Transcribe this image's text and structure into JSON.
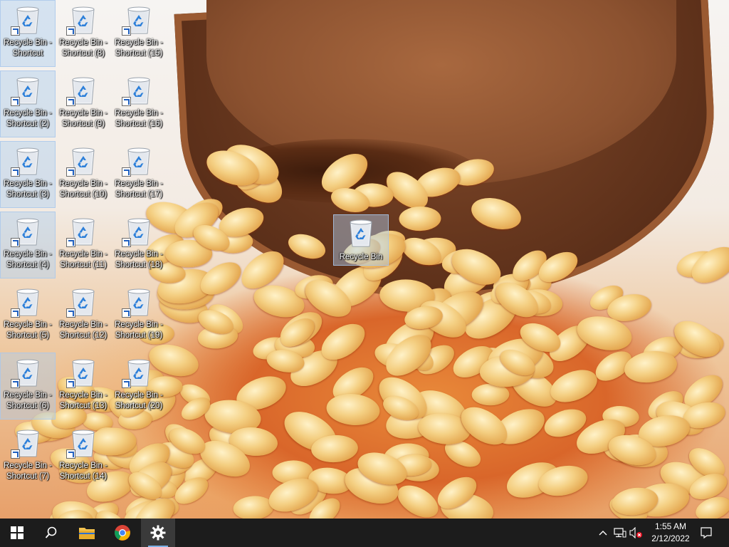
{
  "desktop": {
    "icons": [
      {
        "label": "Recycle Bin -\nShortcut",
        "shortcut": true
      },
      {
        "label": "Recycle Bin -\nShortcut (2)",
        "shortcut": true
      },
      {
        "label": "Recycle Bin -\nShortcut (3)",
        "shortcut": true
      },
      {
        "label": "Recycle Bin -\nShortcut (4)",
        "shortcut": true
      },
      {
        "label": "Recycle Bin -\nShortcut (5)",
        "shortcut": true
      },
      {
        "label": "Recycle Bin -\nShortcut (6)",
        "shortcut": true
      },
      {
        "label": "Recycle Bin -\nShortcut (7)",
        "shortcut": true
      },
      {
        "label": "Recycle Bin -\nShortcut (8)",
        "shortcut": true
      },
      {
        "label": "Recycle Bin -\nShortcut (9)",
        "shortcut": true
      },
      {
        "label": "Recycle Bin -\nShortcut (10)",
        "shortcut": true
      },
      {
        "label": "Recycle Bin -\nShortcut (11)",
        "shortcut": true
      },
      {
        "label": "Recycle Bin -\nShortcut (12)",
        "shortcut": true
      },
      {
        "label": "Recycle Bin -\nShortcut (13)",
        "shortcut": true
      },
      {
        "label": "Recycle Bin -\nShortcut (14)",
        "shortcut": true
      },
      {
        "label": "Recycle Bin -\nShortcut (15)",
        "shortcut": true
      },
      {
        "label": "Recycle Bin -\nShortcut (16)",
        "shortcut": true
      },
      {
        "label": "Recycle Bin -\nShortcut (17)",
        "shortcut": true
      },
      {
        "label": "Recycle Bin -\nShortcut (18)",
        "shortcut": true
      },
      {
        "label": "Recycle Bin -\nShortcut (19)",
        "shortcut": true
      },
      {
        "label": "Recycle Bin -\nShortcut (20)",
        "shortcut": true
      }
    ],
    "main_icon": {
      "label": "Recycle Bin",
      "icon": "recycle-bin-icon"
    }
  },
  "taskbar": {
    "start": {
      "icon": "windows-logo-icon"
    },
    "search": {
      "icon": "search-icon"
    },
    "pinned": [
      {
        "name": "file-explorer",
        "icon": "folder-icon"
      },
      {
        "name": "chrome",
        "icon": "chrome-icon"
      },
      {
        "name": "settings",
        "icon": "gear-icon",
        "active": true
      }
    ],
    "tray": {
      "chevron_icon": "chevron-up-icon",
      "network_icon": "network-icon",
      "volume_icon": "volume-muted-icon",
      "notification_icon": "notification-icon"
    },
    "clock": {
      "time": "1:55 AM",
      "date": "2/12/2022"
    }
  },
  "colors": {
    "taskbar_bg": "#1c1c1c",
    "selection": "#adcef0",
    "active_indicator": "#7db2e6"
  }
}
